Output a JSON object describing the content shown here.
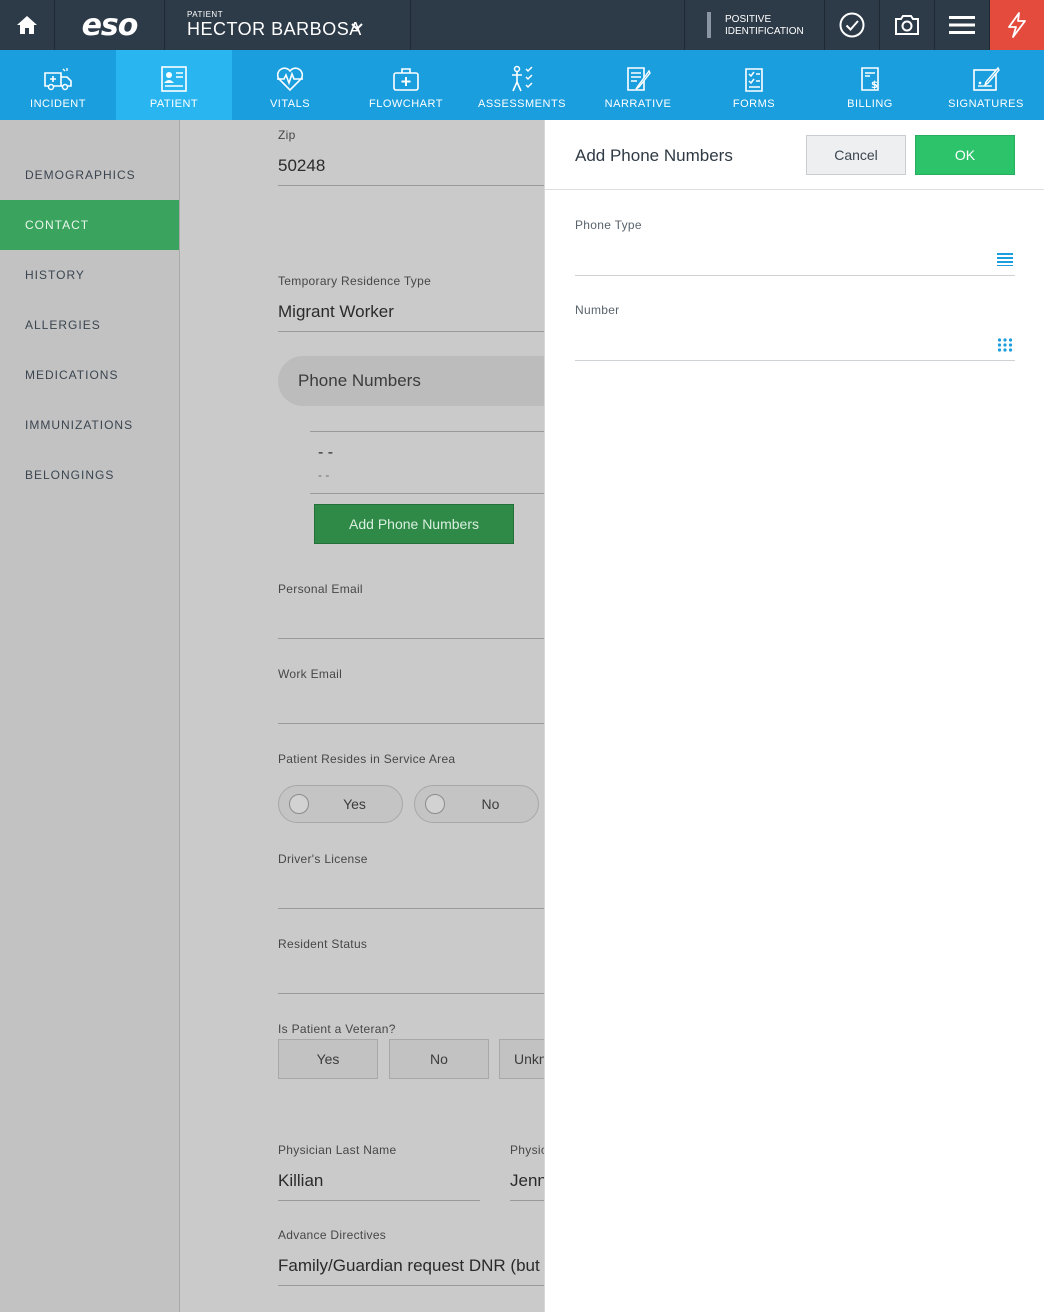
{
  "topbar": {
    "logo": "eso",
    "patient_label": "PATIENT",
    "patient_name": "HECTOR BARBOSA",
    "positive_id_line1": "POSITIVE",
    "positive_id_line2": "IDENTIFICATION"
  },
  "nav": [
    {
      "label": "INCIDENT",
      "icon": "ambulance-icon"
    },
    {
      "label": "PATIENT",
      "icon": "patient-card-icon",
      "active": true
    },
    {
      "label": "VITALS",
      "icon": "heart-pulse-icon"
    },
    {
      "label": "FLOWCHART",
      "icon": "medical-kit-icon"
    },
    {
      "label": "ASSESSMENTS",
      "icon": "body-check-icon"
    },
    {
      "label": "NARRATIVE",
      "icon": "document-pen-icon"
    },
    {
      "label": "FORMS",
      "icon": "checklist-icon"
    },
    {
      "label": "BILLING",
      "icon": "invoice-icon"
    },
    {
      "label": "SIGNATURES",
      "icon": "signature-icon"
    }
  ],
  "sidebar": {
    "items": [
      "DEMOGRAPHICS",
      "CONTACT",
      "HISTORY",
      "ALLERGIES",
      "MEDICATIONS",
      "IMMUNIZATIONS",
      "BELONGINGS"
    ],
    "active": "CONTACT"
  },
  "form": {
    "zip_label": "Zip",
    "zip_value": "50248",
    "temp_res_label": "Temporary Residence Type",
    "temp_res_value": "Migrant Worker",
    "phone_section": "Phone Numbers",
    "phone_entry_main": "- -",
    "phone_entry_sub": "- -",
    "add_phone_button": "Add Phone Numbers",
    "personal_email_label": "Personal Email",
    "work_email_label": "Work Email",
    "service_area_label": "Patient Resides in Service Area",
    "service_yes": "Yes",
    "service_no": "No",
    "drivers_license_label": "Driver's License",
    "resident_status_label": "Resident Status",
    "veteran_label": "Is Patient a Veteran?",
    "veteran_yes": "Yes",
    "veteran_no": "No",
    "veteran_unknown": "Unkn",
    "physician_last_label": "Physician Last Name",
    "physician_last_value": "Killian",
    "physician_first_label": "Physic",
    "physician_first_value": "Jenn",
    "advance_directives_label": "Advance Directives",
    "advance_directives_value": "Family/Guardian request DNR (but"
  },
  "panel": {
    "title": "Add Phone Numbers",
    "cancel": "Cancel",
    "ok": "OK",
    "phone_type_label": "Phone Type",
    "number_label": "Number"
  },
  "colors": {
    "header": "#2d3a48",
    "nav": "#1a9ede",
    "active_green": "#3aa35d",
    "ok_green": "#2cc36b",
    "alert_red": "#e44b3d"
  }
}
